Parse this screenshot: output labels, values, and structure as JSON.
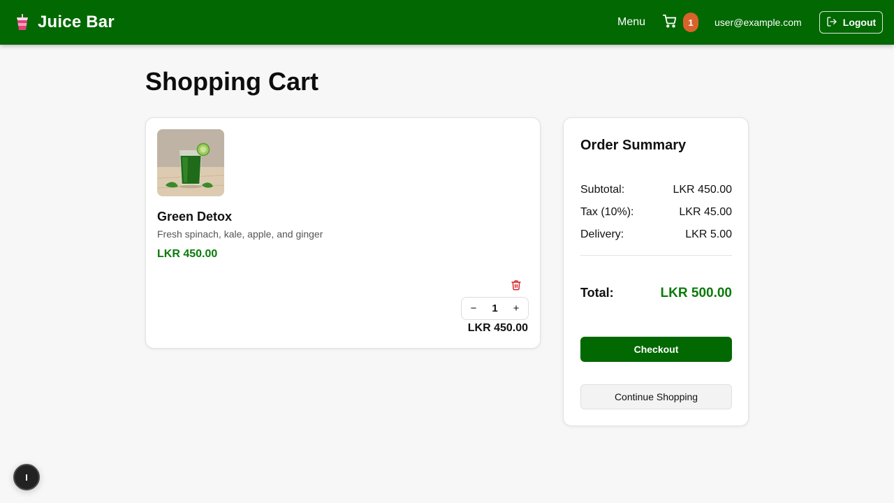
{
  "header": {
    "brand_icon": "juice-cup-icon",
    "brand_title": "Juice Bar",
    "menu_label": "Menu",
    "cart_icon": "cart-icon",
    "cart_count": "1",
    "user_email": "user@example.com",
    "logout_label": "Logout",
    "logout_icon": "logout-icon"
  },
  "page": {
    "title": "Shopping Cart"
  },
  "cart": {
    "items": [
      {
        "image_icon": "green-juice-image",
        "name": "Green Detox",
        "description": "Fresh spinach, kale, apple, and ginger",
        "price": "LKR 450.00",
        "delete_icon": "trash-icon",
        "decrement": "−",
        "quantity": "1",
        "increment": "+",
        "line_total": "LKR 450.00"
      }
    ]
  },
  "summary": {
    "title": "Order Summary",
    "subtotal_label": "Subtotal:",
    "subtotal_value": "LKR 450.00",
    "tax_label": "Tax (10%):",
    "tax_value": "LKR 45.00",
    "delivery_label": "Delivery:",
    "delivery_value": "LKR 5.00",
    "total_label": "Total:",
    "total_value": "LKR 500.00",
    "checkout_label": "Checkout",
    "continue_label": "Continue Shopping"
  },
  "floating_button": {
    "label": "I"
  },
  "colors": {
    "brand_green": "#026802",
    "price_green": "#0a7a0a",
    "badge_orange": "#d9622b",
    "delete_red": "#d2232a"
  }
}
